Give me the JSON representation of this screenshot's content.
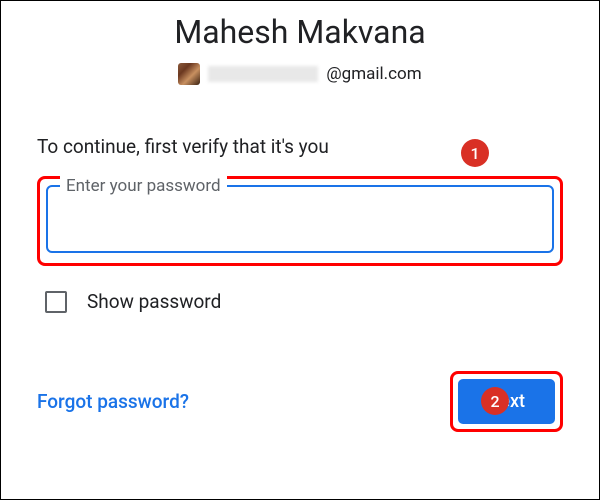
{
  "header": {
    "display_name": "Mahesh Makvana",
    "email_domain": "@gmail.com"
  },
  "instruction": "To continue, first verify that it's you",
  "password_field": {
    "label": "Enter your password",
    "value": ""
  },
  "show_password": {
    "label": "Show password",
    "checked": false
  },
  "footer": {
    "forgot_label": "Forgot password?",
    "next_label": "Next"
  },
  "callouts": {
    "one": "1",
    "two": "2"
  },
  "colors": {
    "primary": "#1a73e8",
    "annotation": "#d93025"
  }
}
